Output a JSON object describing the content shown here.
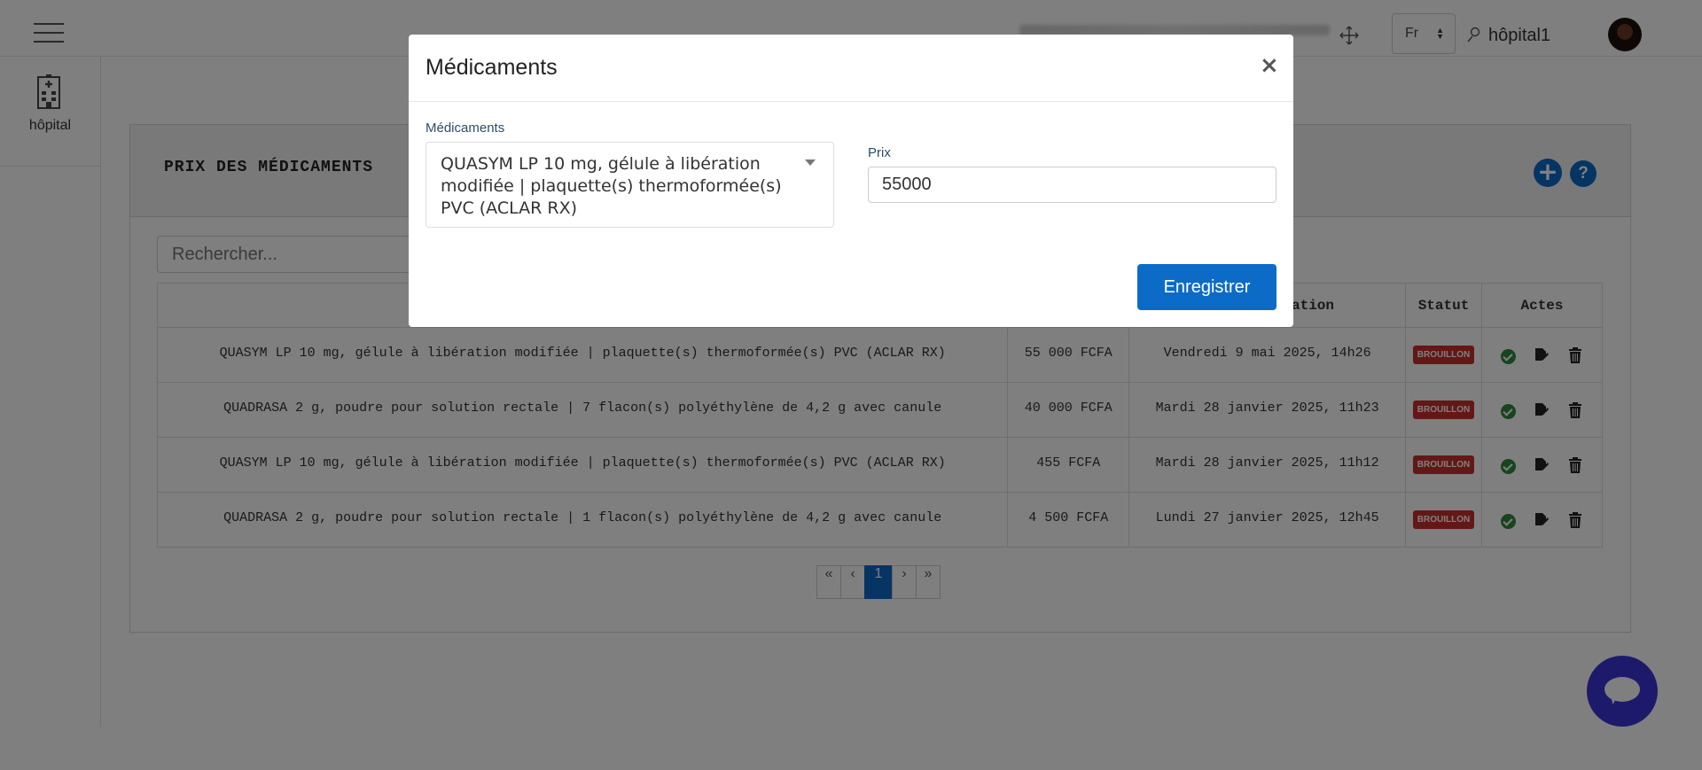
{
  "header": {
    "lang": "Fr",
    "user": "hôpital1"
  },
  "sidebar": {
    "items": [
      {
        "label": "hôpital",
        "icon": "hospital-icon"
      }
    ]
  },
  "page": {
    "title": "PRIX DES MÉDICAMENTS",
    "search_placeholder": "Rechercher...",
    "columns": {
      "date": "ation",
      "status": "Statut",
      "actions": "Actes"
    }
  },
  "table": {
    "rows": [
      {
        "med": "QUASYM LP 10 mg, gélule à libération modifiée | plaquette(s) thermoformée(s) PVC (ACLAR RX)",
        "price": "55 000 FCFA",
        "date": "Vendredi 9 mai 2025, 14h26",
        "status": "BROUILLON"
      },
      {
        "med": "QUADRASA 2 g, poudre pour solution rectale | 7 flacon(s) polyéthylène de 4,2 g avec canule",
        "price": "40 000 FCFA",
        "date": "Mardi 28 janvier 2025, 11h23",
        "status": "BROUILLON"
      },
      {
        "med": "QUASYM LP 10 mg, gélule à libération modifiée | plaquette(s) thermoformée(s) PVC (ACLAR RX)",
        "price": "455 FCFA",
        "date": "Mardi 28 janvier 2025, 11h12",
        "status": "BROUILLON"
      },
      {
        "med": "QUADRASA 2 g, poudre pour solution rectale | 1 flacon(s) polyéthylène de 4,2 g avec canule",
        "price": "4 500 FCFA",
        "date": "Lundi 27 janvier 2025, 12h45",
        "status": "BROUILLON"
      }
    ]
  },
  "pagination": {
    "first": "«",
    "prev": "‹",
    "current": "1",
    "next": "›",
    "last": "»"
  },
  "modal": {
    "title": "Médicaments",
    "close": "×",
    "med_label": "Médicaments",
    "med_value": "QUASYM LP 10 mg, gélule à libération modifiée | plaquette(s) thermoformée(s) PVC (ACLAR RX)",
    "price_label": "Prix",
    "price_value": "55000",
    "save": "Enregistrer"
  },
  "colors": {
    "primary": "#0d6bc8",
    "danger": "#c9302c",
    "success": "#2e8b3a",
    "chat": "#3a35d9"
  }
}
